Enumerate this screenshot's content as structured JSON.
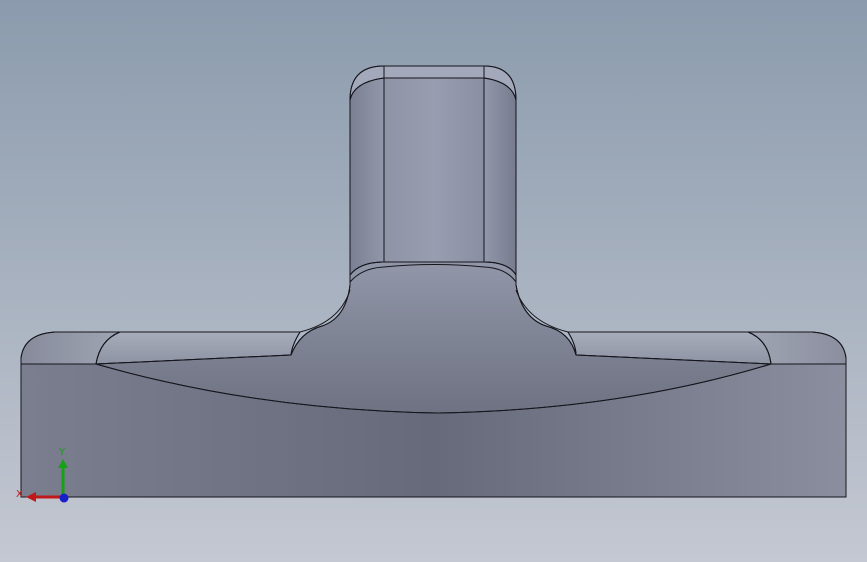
{
  "viewport": {
    "background_top": "#8a9aac",
    "background_bottom": "#c3c7d1"
  },
  "model": {
    "base_color_dark": "#686c7c",
    "base_color_light": "#8a8e9e",
    "top_face_color": "#9aa0b2",
    "edge_color": "#1a1a22"
  },
  "triad": {
    "x_label": "X",
    "y_label": "Y",
    "x_color": "#c01818",
    "y_color": "#18a018",
    "z_color": "#1820c8"
  }
}
